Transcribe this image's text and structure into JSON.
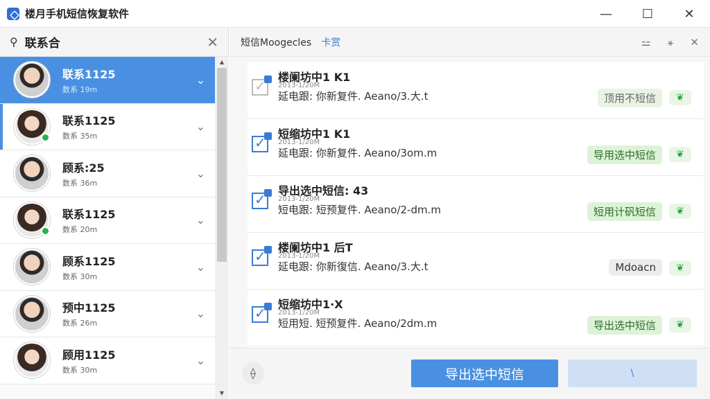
{
  "window": {
    "title": "楼月手机短信恢复软件",
    "minimize": "—",
    "maximize": "☐",
    "close": "✕"
  },
  "sidebar": {
    "title": "联系合",
    "icon": "contacts-icon",
    "close_glyph": "✕",
    "contacts": [
      {
        "name": "联系1125",
        "sub": "数系 19m",
        "selected": true,
        "online": false,
        "avatar": "male"
      },
      {
        "name": "联系1125",
        "sub": "数系 35m",
        "selected": false,
        "online": true,
        "avatar": "female"
      },
      {
        "name": "顾系:25",
        "sub": "数系 36m",
        "selected": false,
        "online": false,
        "avatar": "male"
      },
      {
        "name": "联系1125",
        "sub": "数系 20m",
        "selected": false,
        "online": true,
        "avatar": "female"
      },
      {
        "name": "顾系1125",
        "sub": "数系 30m",
        "selected": false,
        "online": false,
        "avatar": "male"
      },
      {
        "name": "预中1125",
        "sub": "数系 26m",
        "selected": false,
        "online": false,
        "avatar": "male"
      },
      {
        "name": "顾用1125",
        "sub": "数系 30m",
        "selected": false,
        "online": false,
        "avatar": "female"
      }
    ]
  },
  "main": {
    "title": "短信Moogecles",
    "tab": "卡赏",
    "tools": [
      "⚍",
      "⚹",
      "✕"
    ],
    "messages": [
      {
        "title": "楼阑坊中1 K1",
        "date": "2013-1/20M",
        "body": "延电跟: 你新复件. Aeano/3.大.t",
        "tag": "顶用不短信",
        "tag_style": "faded",
        "checked_style": "faded"
      },
      {
        "title": "短缩坊中1 K1",
        "date": "2013-1/20M",
        "body": "延电跟: 你新复件. Aeano/3om.m",
        "tag": "导用选中短信",
        "tag_style": "green",
        "checked_style": "normal"
      },
      {
        "title": "导出选中短信: 43",
        "date": "2013-1/20M",
        "body": "短电跟: 短预复件. Aeano/2-dm.m",
        "tag": "短用计矾短信",
        "tag_style": "green",
        "checked_style": "normal"
      },
      {
        "title": "楼阑坊中1 后T",
        "date": "2013-1/20M",
        "body": "延电跟: 你新復信. Aeano/3.大.t",
        "tag": "Mdoacn",
        "tag_style": "gray",
        "checked_style": "normal"
      },
      {
        "title": "短缩坊中1·X",
        "date": "2013-1/20M",
        "body": "短用短. 短预复件. Aeano/2dm.m",
        "tag": "导出选中短信",
        "tag_style": "green",
        "checked_style": "normal"
      }
    ],
    "footer": {
      "export_label": "导出选中短信",
      "second_label": "\\",
      "left_icon_glyph": "⟠"
    }
  }
}
